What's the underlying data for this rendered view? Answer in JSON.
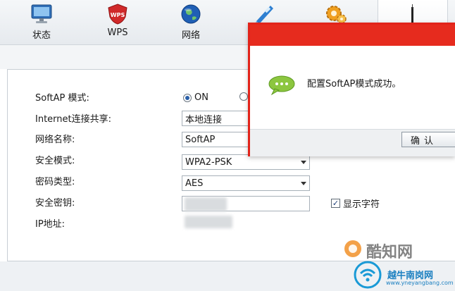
{
  "toolbar": {
    "items": [
      {
        "label": "状态",
        "icon": "monitor-icon"
      },
      {
        "label": "WPS",
        "icon": "wps-shield-icon"
      },
      {
        "label": "网络",
        "icon": "globe-icon"
      },
      {
        "label": "",
        "icon": "wireless-icon"
      },
      {
        "label": "",
        "icon": "gear-icon"
      },
      {
        "label": "",
        "icon": "router-icon"
      }
    ]
  },
  "form": {
    "softap_mode": {
      "label": "SoftAP 模式:",
      "on_label": "ON",
      "selected": "ON"
    },
    "internet_sharing": {
      "label": "Internet连接共享:",
      "value": "本地连接"
    },
    "network_name": {
      "label": "网络名称:",
      "value": "SoftAP"
    },
    "security_mode": {
      "label": "安全模式:",
      "value": "WPA2-PSK"
    },
    "cipher_type": {
      "label": "密码类型:",
      "value": "AES"
    },
    "security_key": {
      "label": "安全密钥:",
      "value": ""
    },
    "show_chars": {
      "label": "显示字符",
      "checked": true
    },
    "ip_address": {
      "label": "IP地址:",
      "value": ""
    }
  },
  "dialog": {
    "message": "配置SoftAP模式成功。",
    "ok_label": "确认",
    "accent_color": "#e62b1e"
  },
  "watermarks": {
    "site_cn": "酷知网",
    "site2_cn": "越牛南岗网",
    "site2_url": "www.yneyangbang.com"
  }
}
